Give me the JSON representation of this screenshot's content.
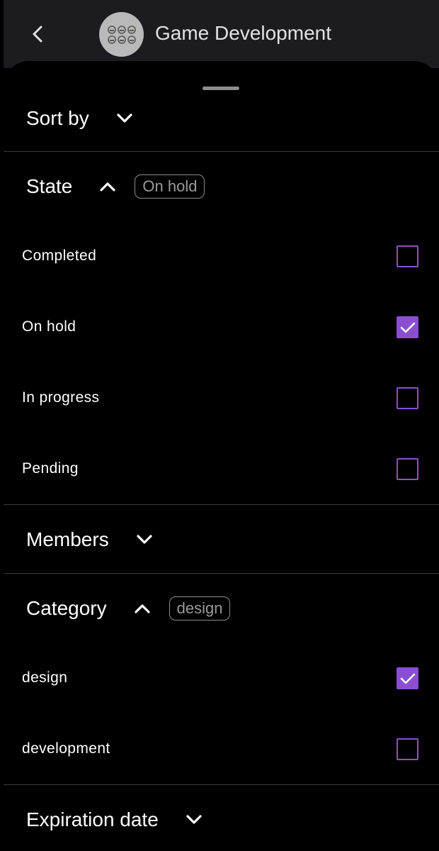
{
  "header": {
    "title": "Game Development",
    "back_icon": "chevron-left-icon",
    "avatar_icon": "group-avatar-icon"
  },
  "filters": {
    "sort_by": {
      "label": "Sort by",
      "expanded": false
    },
    "state": {
      "label": "State",
      "expanded": true,
      "chip": "On hold",
      "options": [
        {
          "label": "Completed",
          "checked": false
        },
        {
          "label": "On hold",
          "checked": true
        },
        {
          "label": "In progress",
          "checked": false
        },
        {
          "label": "Pending",
          "checked": false
        }
      ]
    },
    "members": {
      "label": "Members",
      "expanded": false
    },
    "category": {
      "label": "Category",
      "expanded": true,
      "chip": "design",
      "options": [
        {
          "label": "design",
          "checked": true
        },
        {
          "label": "development",
          "checked": false
        }
      ]
    },
    "expiration_date": {
      "label": "Expiration date",
      "expanded": false
    }
  },
  "colors": {
    "accent": "#8a4fd1",
    "header_bg": "#1c1b1f",
    "sheet_bg": "#000000",
    "divider": "#3a3a3a"
  }
}
